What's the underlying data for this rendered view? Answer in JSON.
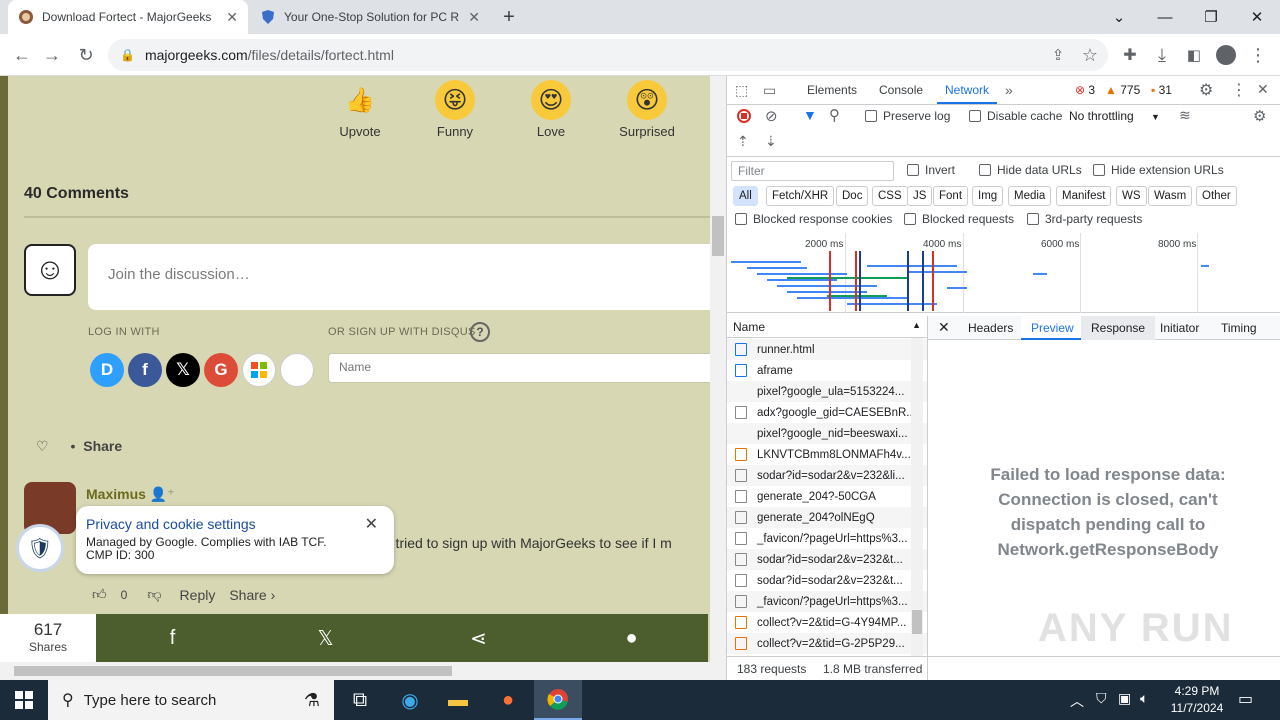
{
  "tabs": [
    {
      "title": "Download Fortect - MajorGeeks"
    },
    {
      "title": "Your One-Stop Solution for PC R"
    }
  ],
  "new_tab_glyph": "+",
  "window_controls": {
    "chevron": "⌄",
    "minimize": "—",
    "restore": "❐",
    "close": "✕"
  },
  "address": {
    "host": "majorgeeks.com",
    "path": "/files/details/fortect.html"
  },
  "reactions": [
    {
      "label": "Upvote",
      "emoji": "👍"
    },
    {
      "label": "Funny",
      "emoji": "😝"
    },
    {
      "label": "Love",
      "emoji": "😍"
    },
    {
      "label": "Surprised",
      "emoji": "😲"
    }
  ],
  "comments": {
    "count_title": "40 Comments",
    "discussion_placeholder": "Join the discussion…",
    "login_with": "LOG IN WITH",
    "signup_with": "OR SIGN UP WITH DISQUS",
    "help_glyph": "?",
    "name_placeholder": "Name",
    "share_label": "Share",
    "author": "Maximus",
    "text": ". I tried to sign up with MajorGeeks to see if I m",
    "likes": "0",
    "reply": "Reply",
    "share_link": "Share ›"
  },
  "privacy": {
    "title": "Privacy and cookie settings",
    "line1": "Managed by Google. Complies with IAB TCF.",
    "line2": "CMP ID: 300"
  },
  "share_bar": {
    "count": "617",
    "label": "Shares"
  },
  "devtools": {
    "tabs": [
      "Elements",
      "Console",
      "Network"
    ],
    "more": "»",
    "errors": "3",
    "warnings": "775",
    "issues": "31",
    "preserve_log": "Preserve log",
    "disable_cache": "Disable cache",
    "throttling": "No throttling",
    "filter_placeholder": "Filter",
    "invert": "Invert",
    "hide_data_urls": "Hide data URLs",
    "hide_ext_urls": "Hide extension URLs",
    "type_filters": [
      "All",
      "Fetch/XHR",
      "Doc",
      "CSS",
      "JS",
      "Font",
      "Img",
      "Media",
      "Manifest",
      "WS",
      "Wasm",
      "Other"
    ],
    "blocked_cookies": "Blocked response cookies",
    "blocked_requests": "Blocked requests",
    "third_party": "3rd-party requests",
    "timeline_ticks": [
      "2000 ms",
      "4000 ms",
      "6000 ms",
      "8000 ms"
    ],
    "name_header": "Name",
    "requests": [
      "runner.html",
      "aframe",
      "pixel?google_ula=5153224...",
      "adx?google_gid=CAESEBnR...",
      "pixel?google_nid=beeswaxi...",
      "LKNVTCBmm8LONMAFh4v...",
      "sodar?id=sodar2&v=232&li...",
      "generate_204?-50CGA",
      "generate_204?olNEgQ",
      "_favicon/?pageUrl=https%3...",
      "sodar?id=sodar2&v=232&t...",
      "sodar?id=sodar2&v=232&t...",
      "_favicon/?pageUrl=https%3...",
      "collect?v=2&tid=G-4Y94MP...",
      "collect?v=2&tid=G-2P5P29..."
    ],
    "detail_tabs": [
      "Headers",
      "Preview",
      "Response",
      "Initiator",
      "Timing"
    ],
    "error_message": "Failed to load response data: Connection is closed, can't dispatch pending call to Network.getResponseBody",
    "request_count": "183 requests",
    "transferred": "1.8 MB transferred"
  },
  "taskbar": {
    "search_placeholder": "Type here to search",
    "time": "4:29 PM",
    "date": "11/7/2024"
  },
  "watermark": "ANY RUN"
}
